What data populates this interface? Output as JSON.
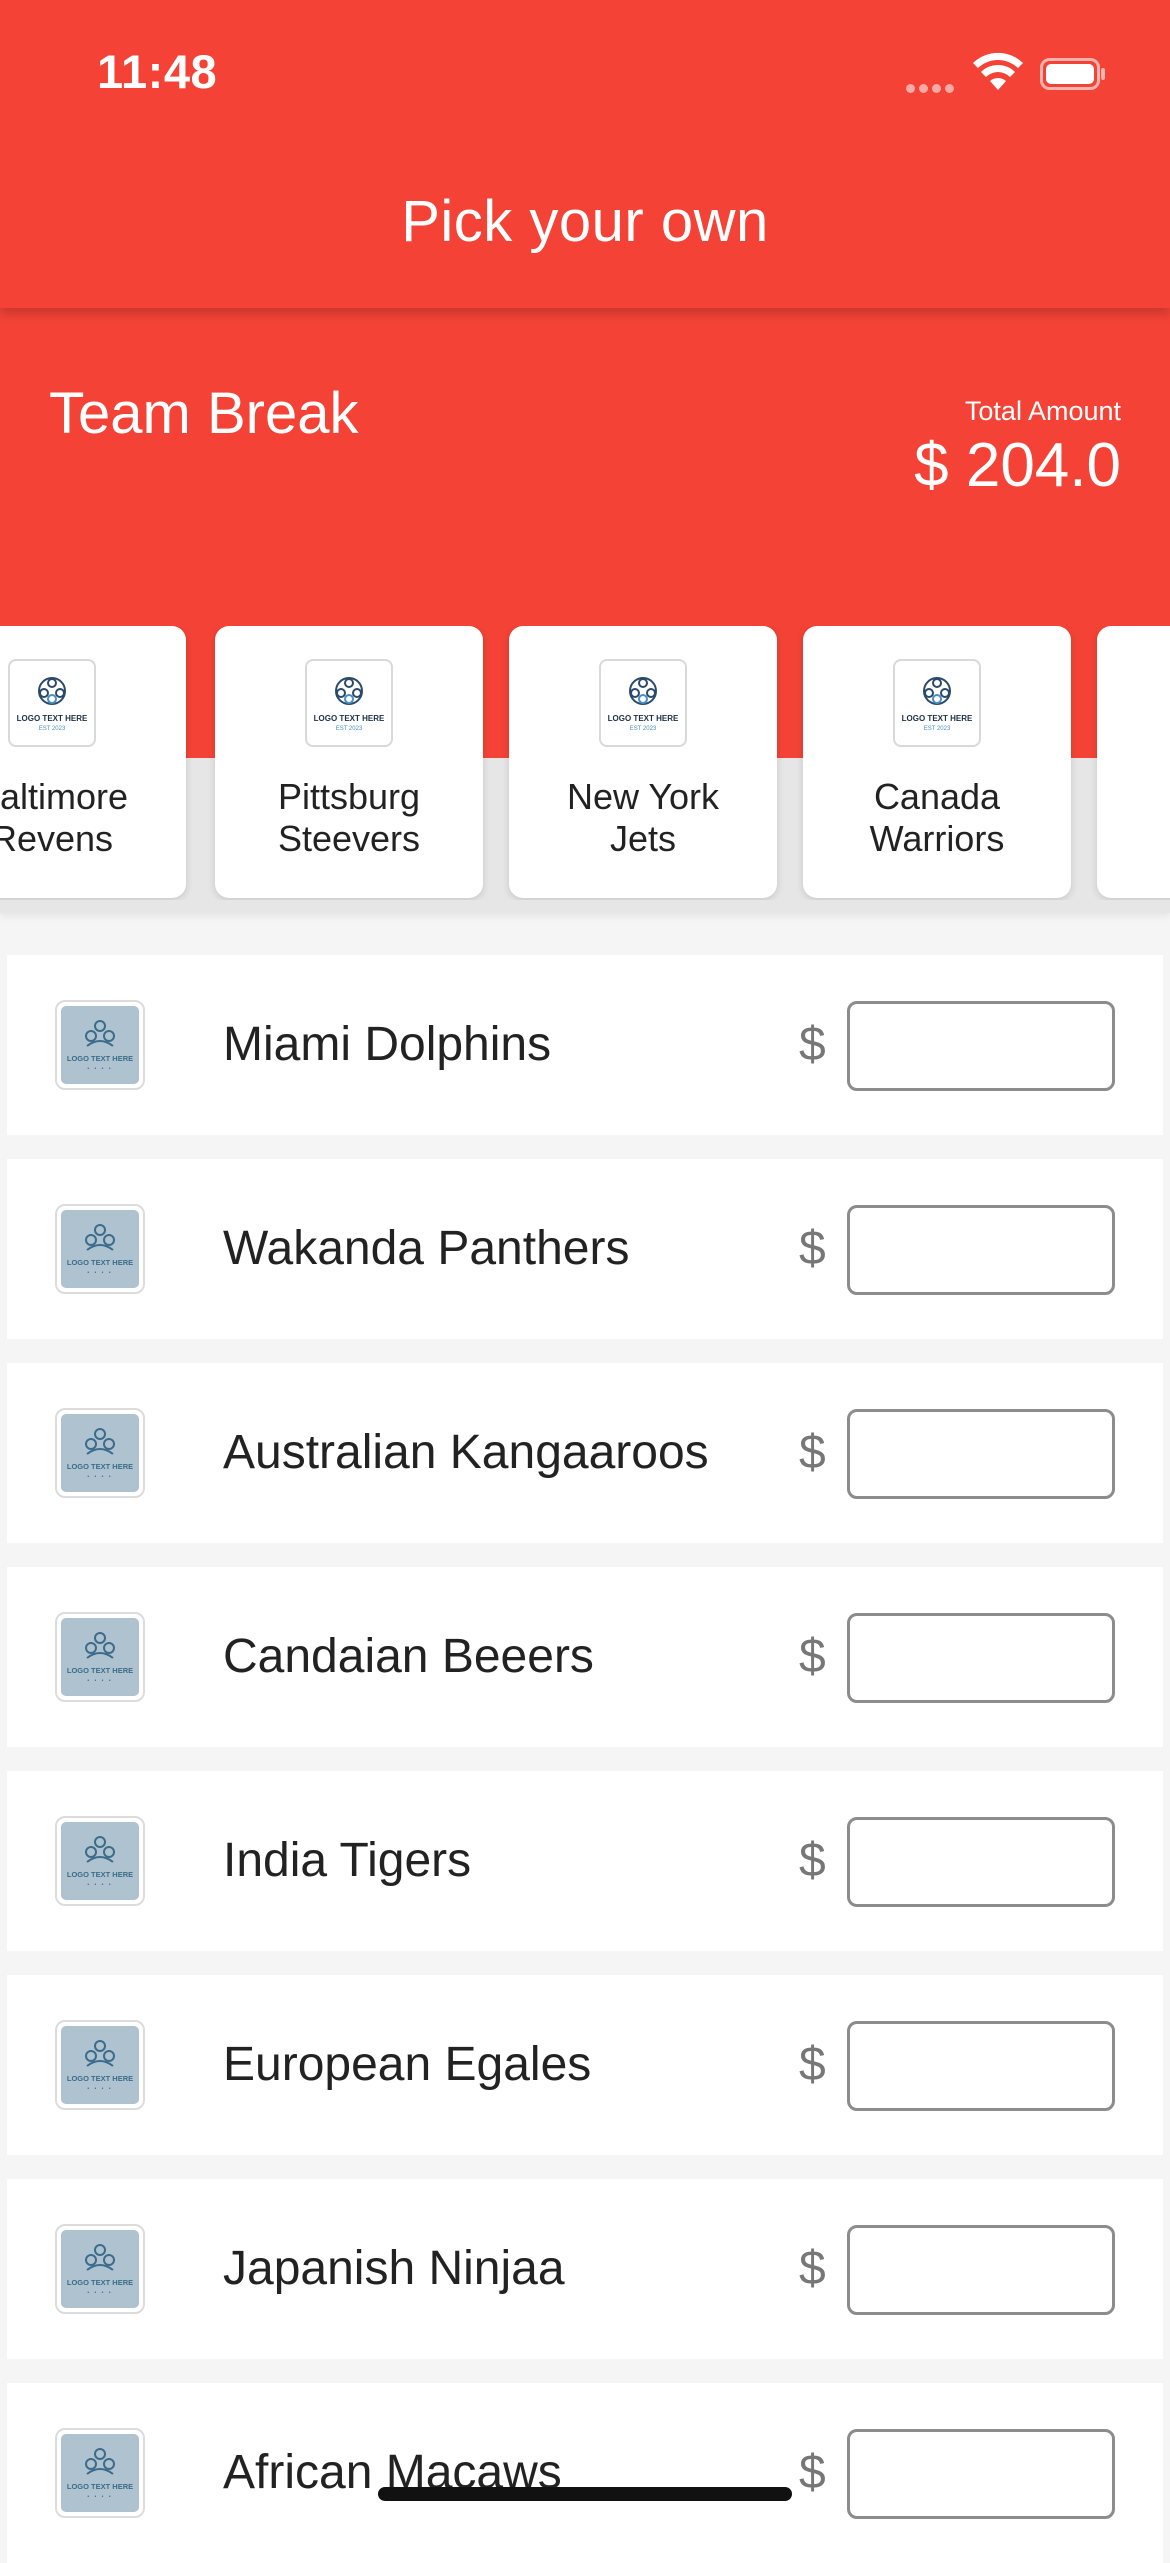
{
  "status_bar": {
    "time": "11:48"
  },
  "app_bar": {
    "title": "Pick your own"
  },
  "header": {
    "title": "Team Break",
    "total_label": "Total Amount",
    "total_amount": "$ 204.0"
  },
  "colors": {
    "primary": "#f44336",
    "logo_tile": "#aec3cf"
  },
  "carousel": {
    "logo_text": "LOGO TEXT HERE",
    "logo_subtext": "EST 2023",
    "cards": [
      {
        "name": "Baltimore\nRevens"
      },
      {
        "name": "Pittsburg\nSteevers"
      },
      {
        "name": "New York\nJets"
      },
      {
        "name": "Canada\nWarriors"
      },
      {
        "name": ""
      }
    ]
  },
  "list": {
    "currency_symbol": "$",
    "logo_text": "LOGO TEXT HERE",
    "teams": [
      {
        "name": "Miami Dolphins",
        "amount": ""
      },
      {
        "name": "Wakanda Panthers",
        "amount": ""
      },
      {
        "name": "Australian Kangaaroos",
        "amount": ""
      },
      {
        "name": "Candaian Beeers",
        "amount": ""
      },
      {
        "name": "India Tigers",
        "amount": ""
      },
      {
        "name": "European Egales",
        "amount": ""
      },
      {
        "name": "Japanish Ninjaa",
        "amount": ""
      },
      {
        "name": "African Macaws",
        "amount": ""
      }
    ]
  }
}
